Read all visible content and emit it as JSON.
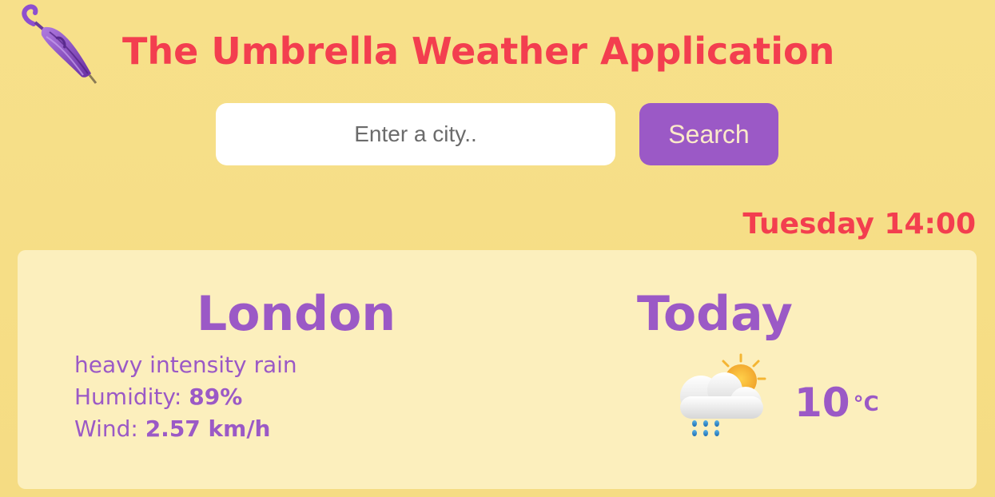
{
  "header": {
    "logo_icon": "closed-umbrella-icon",
    "title": "The Umbrella Weather Application"
  },
  "search": {
    "placeholder": "Enter a city..",
    "value": "",
    "button_label": "Search"
  },
  "datetime": "Tuesday 14:00",
  "current": {
    "city": "London",
    "description": "heavy intensity rain",
    "humidity_label": "Humidity: ",
    "humidity_value": "89%",
    "wind_label": "Wind: ",
    "wind_value": "2.57 km/h"
  },
  "today": {
    "title": "Today",
    "icon": "sun-behind-rain-cloud-icon",
    "temperature": "10",
    "unit": "°C"
  },
  "colors": {
    "background": "#f7e08a",
    "card": "#fcefbd",
    "accent_red": "#f33e4f",
    "accent_purple": "#9b59c6",
    "button_text": "#fbe9c9"
  }
}
